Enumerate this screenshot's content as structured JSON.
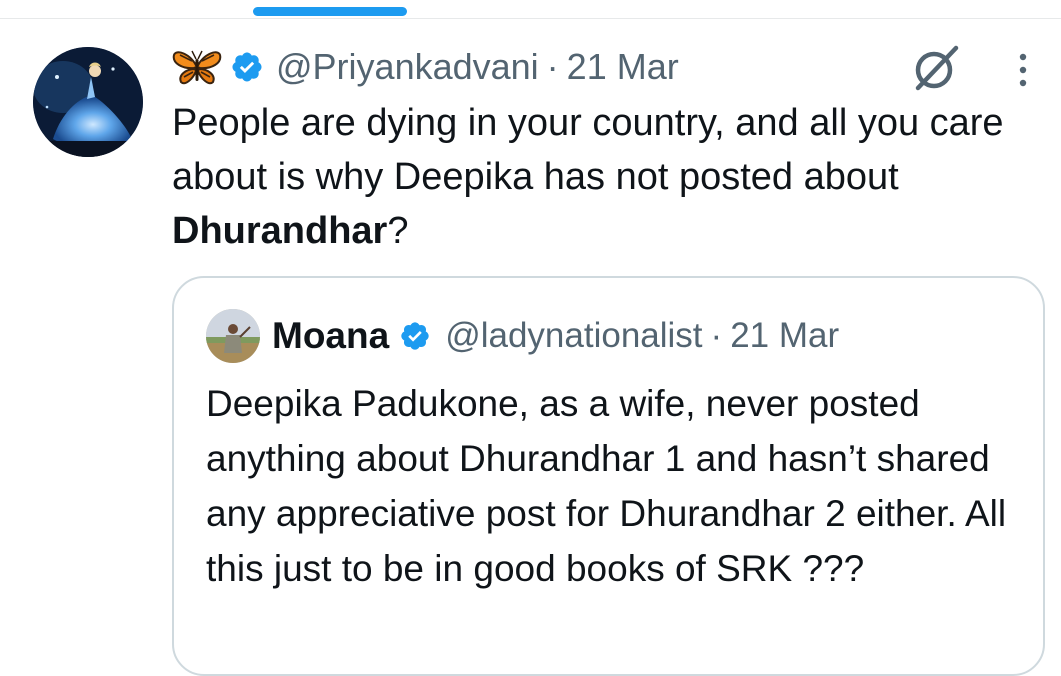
{
  "tweet": {
    "emoji": "🦋",
    "handle": "@Priyankadvani",
    "separator": "·",
    "date": "21 Mar",
    "text_before": "People are dying in your country, and all you care about is why Deepika has not posted about ",
    "text_bold": "Dhurandhar",
    "text_after": "?"
  },
  "quote": {
    "name": "Moana",
    "handle": "@ladynationalist",
    "separator": "·",
    "date": "21 Mar",
    "text": "Deepika Padukone, as a wife, never posted anything about Dhurandhar 1 and hasn’t shared any appreciative post for Dhurandhar 2 either. All this just to be in good books of SRK ???"
  },
  "icons": {
    "butterfly": "butterfly-icon",
    "verified": "verified-badge-icon",
    "grok": "grok-icon",
    "more": "more-options-icon"
  },
  "colors": {
    "accent": "#1d9bf0",
    "secondary_text": "#536471",
    "primary_text": "#0f1419",
    "border": "#cfd9de"
  }
}
